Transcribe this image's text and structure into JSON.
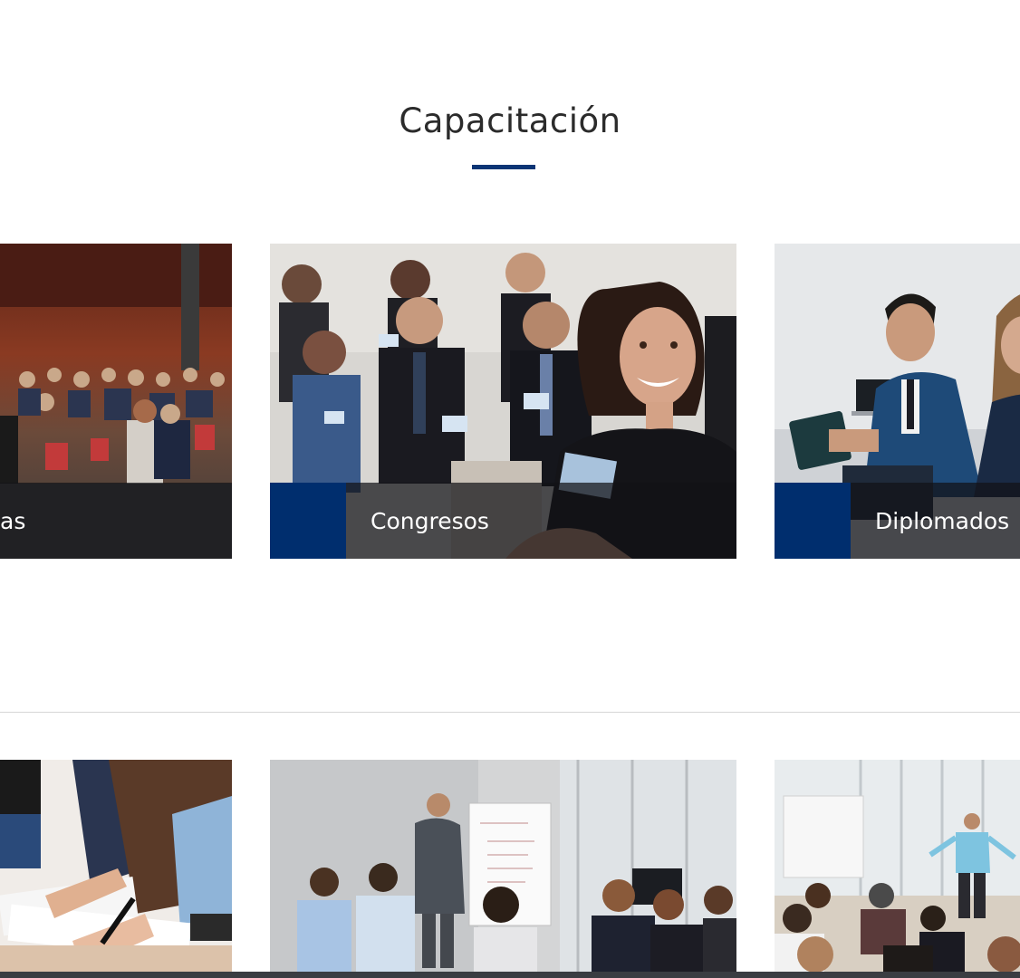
{
  "section": {
    "title": "Capacitación",
    "accent_color": "#0b3575"
  },
  "cards_row1": [
    {
      "label": "as"
    },
    {
      "label": "Congresos"
    },
    {
      "label": "Diplomados"
    }
  ],
  "cards_row2": [
    {
      "label": ""
    },
    {
      "label": ""
    },
    {
      "label": ""
    }
  ],
  "colors": {
    "caption_accent": "#002e6e",
    "caption_overlay": "#121216"
  }
}
